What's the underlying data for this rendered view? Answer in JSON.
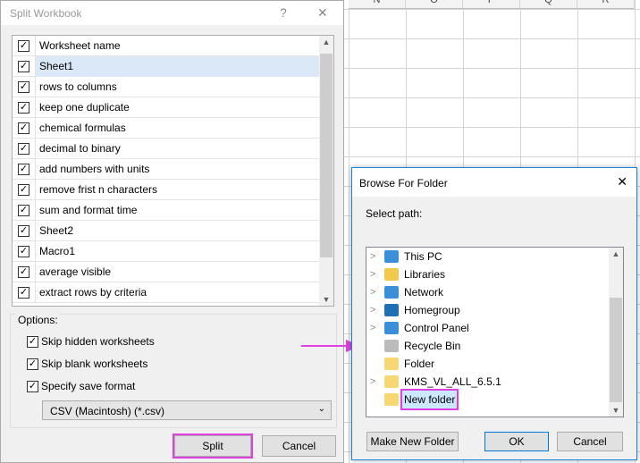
{
  "spreadsheet": {
    "columns": [
      "N",
      "O",
      "P",
      "Q",
      "R"
    ]
  },
  "split_dialog": {
    "title": "Split Workbook",
    "help": "?",
    "close": "✕",
    "list_header": "Worksheet name",
    "sheets": [
      {
        "name": "Sheet1",
        "checked": true,
        "selected": true
      },
      {
        "name": "rows to columns",
        "checked": true
      },
      {
        "name": "keep one duplicate",
        "checked": true
      },
      {
        "name": "chemical formulas",
        "checked": true
      },
      {
        "name": "decimal to binary",
        "checked": true
      },
      {
        "name": "add numbers with units",
        "checked": true
      },
      {
        "name": "remove frist n characters",
        "checked": true
      },
      {
        "name": "sum and format time",
        "checked": true
      },
      {
        "name": "Sheet2",
        "checked": true
      },
      {
        "name": "Macro1",
        "checked": true
      },
      {
        "name": "average visible",
        "checked": true
      },
      {
        "name": "extract rows by criteria",
        "checked": true
      }
    ],
    "options_label": "Options:",
    "options": [
      {
        "label": "Skip hidden worksheets",
        "checked": true
      },
      {
        "label": "Skip blank worksheets",
        "checked": true
      },
      {
        "label": "Specify save format",
        "checked": true
      }
    ],
    "save_format": "CSV (Macintosh) (*.csv)",
    "split_label": "Split",
    "cancel_label": "Cancel"
  },
  "browse_dialog": {
    "title": "Browse For Folder",
    "close": "✕",
    "select_path": "Select path:",
    "nodes": [
      {
        "label": "This PC",
        "icon": "computer-icon",
        "expandable": true
      },
      {
        "label": "Libraries",
        "icon": "libraries-icon",
        "expandable": true
      },
      {
        "label": "Network",
        "icon": "network-icon",
        "expandable": true
      },
      {
        "label": "Homegroup",
        "icon": "homegroup-icon",
        "expandable": true
      },
      {
        "label": "Control Panel",
        "icon": "control-panel-icon",
        "expandable": true
      },
      {
        "label": "Recycle Bin",
        "icon": "recycle-bin-icon",
        "expandable": false
      },
      {
        "label": "Folder",
        "icon": "folder-icon",
        "expandable": false
      },
      {
        "label": "KMS_VL_ALL_6.5.1",
        "icon": "folder-icon",
        "expandable": true
      },
      {
        "label": "New folder",
        "icon": "folder-icon",
        "expandable": false,
        "selected": true
      }
    ],
    "make_new_folder": "Make New Folder",
    "ok": "OK",
    "cancel": "Cancel"
  },
  "highlight_color": "#e040e0"
}
